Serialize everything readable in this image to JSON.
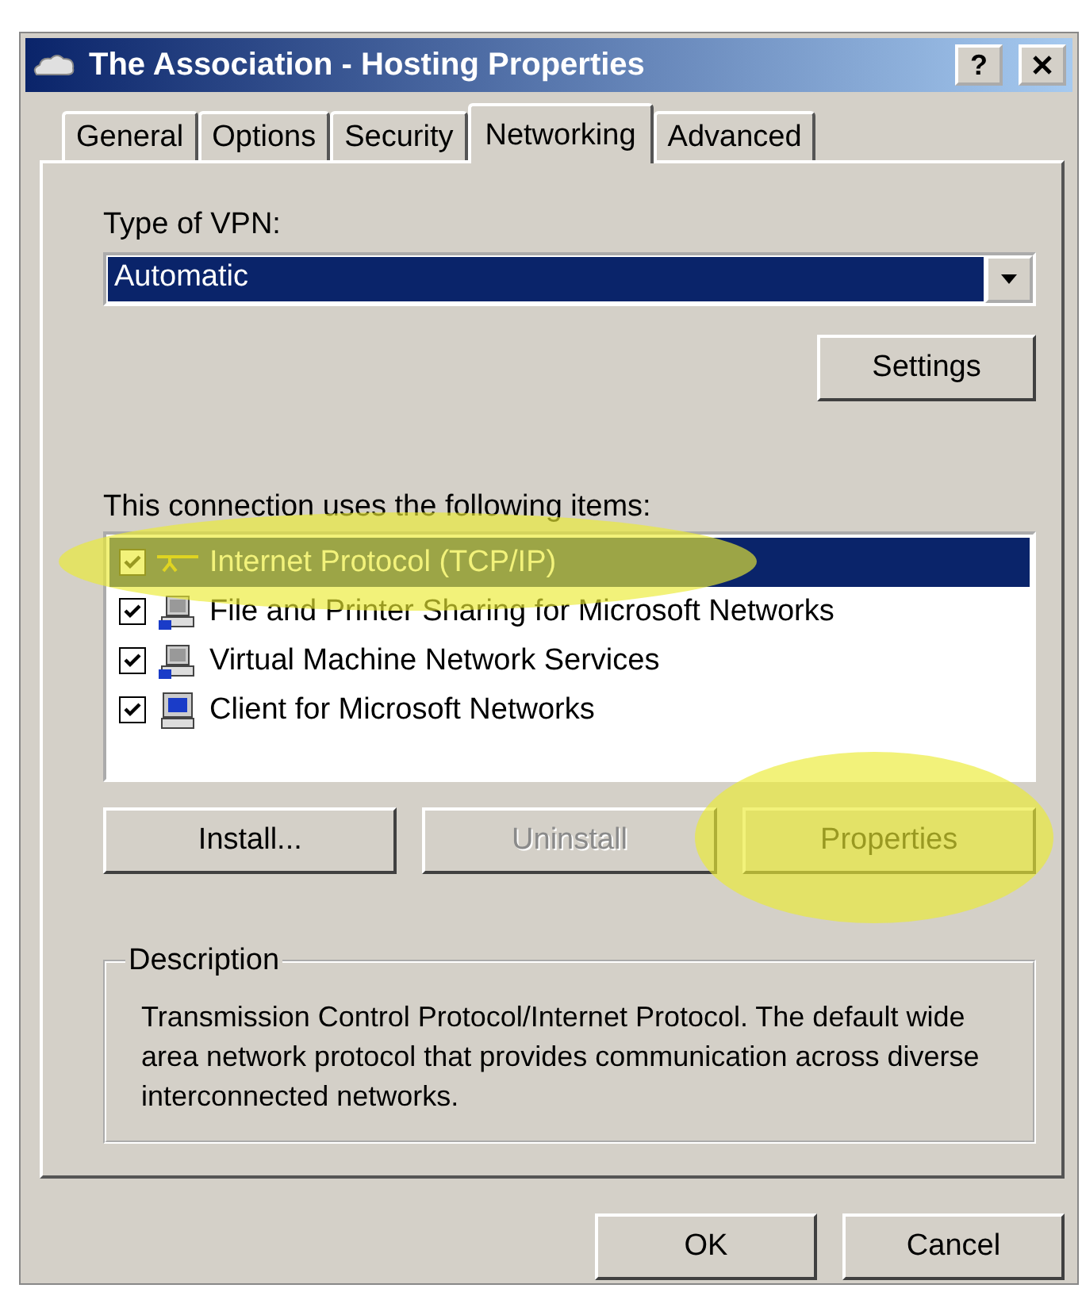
{
  "window": {
    "title": "The Association - Hosting Properties"
  },
  "tabs": [
    {
      "label": "General",
      "selected": false
    },
    {
      "label": "Options",
      "selected": false
    },
    {
      "label": "Security",
      "selected": false
    },
    {
      "label": "Networking",
      "selected": true
    },
    {
      "label": "Advanced",
      "selected": false
    }
  ],
  "help_button": "?",
  "vpn_type": {
    "label": "Type of VPN:",
    "value": "Automatic"
  },
  "settings_button": "Settings",
  "items_label": "This connection uses the following items:",
  "items": [
    {
      "label": "Internet Protocol (TCP/IP)",
      "kind": "protocol",
      "checked": true,
      "selected": true,
      "highlighted": true
    },
    {
      "label": "File and Printer Sharing for Microsoft Networks",
      "kind": "service",
      "checked": true,
      "selected": false,
      "highlighted": false
    },
    {
      "label": "Virtual Machine Network Services",
      "kind": "service",
      "checked": true,
      "selected": false,
      "highlighted": false
    },
    {
      "label": "Client for Microsoft Networks",
      "kind": "client",
      "checked": true,
      "selected": false,
      "highlighted": false
    }
  ],
  "item_buttons": [
    {
      "label": "Install...",
      "disabled": false,
      "highlighted": false
    },
    {
      "label": "Uninstall",
      "disabled": true,
      "highlighted": false
    },
    {
      "label": "Properties",
      "disabled": false,
      "highlighted": true
    }
  ],
  "description": {
    "title": "Description",
    "text": "Transmission Control Protocol/Internet Protocol. The default wide area network protocol that provides communication across diverse interconnected networks."
  },
  "dialog_buttons": [
    "OK",
    "Cancel"
  ]
}
